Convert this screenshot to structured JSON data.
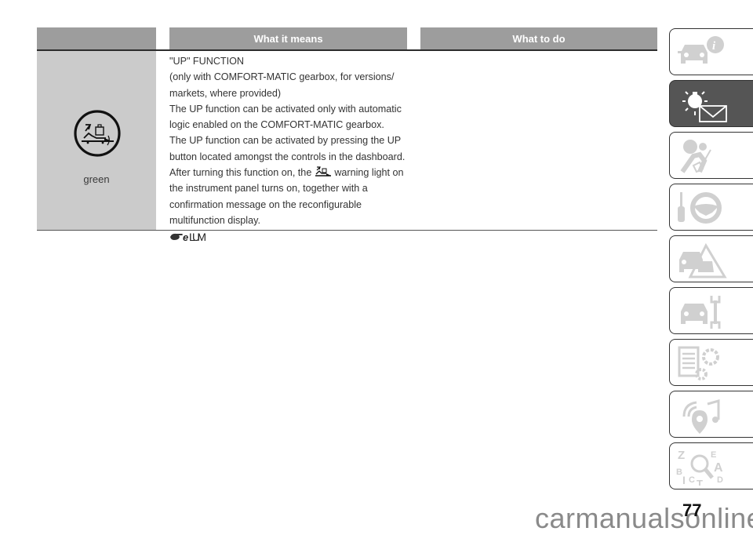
{
  "table": {
    "headers": [
      "",
      "What it means",
      "What to do"
    ],
    "rows": [
      {
        "icon": "up-function-warning-light-icon",
        "color_label": "green",
        "meaning_lines": [
          "\"UP\" FUNCTION",
          "(only with COMFORT-MATIC gearbox, for versions/",
          "markets, where provided)",
          "The UP function can be activated only with automatic",
          "logic enabled on the COMFORT-MATIC gearbox.",
          "The UP function can be activated by pressing the UP",
          "button located amongst the controls in the dashboard."
        ],
        "meaning_inline_before": "After turning this function on, the",
        "meaning_inline_after": "warning light on",
        "meaning_lines_after": [
          "the instrument panel turns on, together with a",
          "confirmation message on the reconfigurable",
          "multifunction display."
        ],
        "reference_mark": "eLUM",
        "what_to_do": ""
      }
    ]
  },
  "sidebar": {
    "tabs": [
      {
        "name": "knowing-your-car",
        "icon": "car-info-icon",
        "active": false
      },
      {
        "name": "instrument-panel",
        "icon": "light-bulb-message-icon",
        "active": true
      },
      {
        "name": "safety",
        "icon": "airbag-seatbelt-icon",
        "active": false
      },
      {
        "name": "starting-and-driving",
        "icon": "key-steering-wheel-icon",
        "active": false
      },
      {
        "name": "in-an-emergency",
        "icon": "car-warning-triangle-icon",
        "active": false
      },
      {
        "name": "servicing-and-care",
        "icon": "car-wrench-icon",
        "active": false
      },
      {
        "name": "technical-specifications",
        "icon": "list-gears-icon",
        "active": false
      },
      {
        "name": "multimedia",
        "icon": "music-location-icon",
        "active": false
      },
      {
        "name": "index",
        "icon": "alphabet-search-icon",
        "active": false
      }
    ]
  },
  "footer": {
    "page_number": "77",
    "watermark": "carmanualsonline.info"
  },
  "colors": {
    "header_bg": "#9d9d9d",
    "icon_cell_bg": "#cbcbcb",
    "active_tab_bg": "#555555",
    "inactive_icon": "#d0d0d0"
  }
}
